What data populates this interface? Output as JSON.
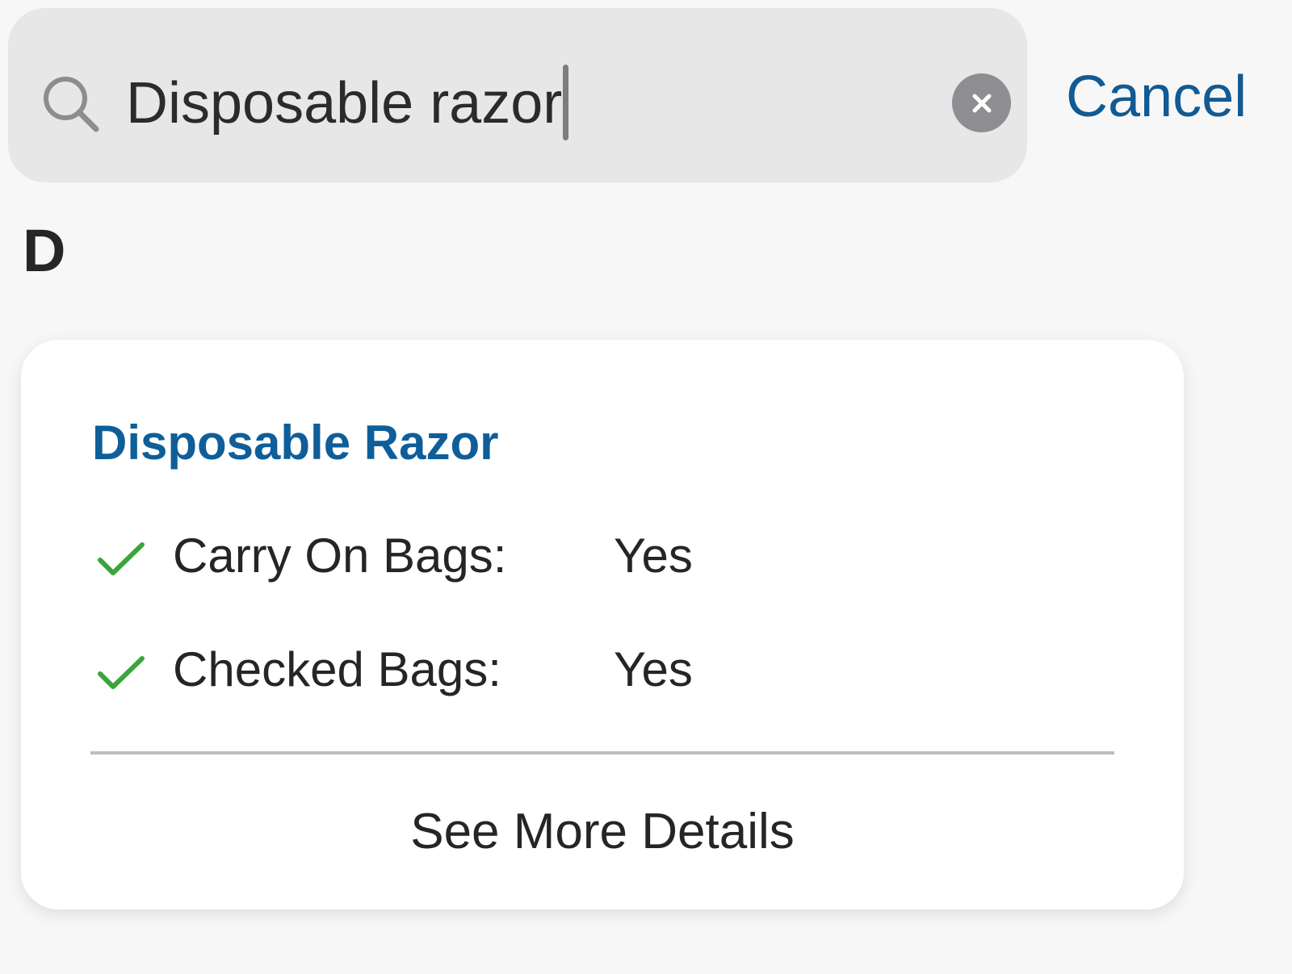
{
  "search": {
    "value": "Disposable razor",
    "cancel_label": "Cancel",
    "search_icon": "search-icon",
    "clear_icon": "clear-icon"
  },
  "results": {
    "section_letter": "D",
    "card": {
      "title": "Disposable Razor",
      "rows": [
        {
          "icon": "checkmark-icon",
          "label": "Carry On Bags:",
          "value": "Yes"
        },
        {
          "icon": "checkmark-icon",
          "label": "Checked Bags:",
          "value": "Yes"
        }
      ],
      "details_label": "See More Details"
    }
  },
  "colors": {
    "accent_blue": "#115a93",
    "title_blue": "#0e5e99",
    "check_green": "#3aa53a",
    "search_bg": "#e7e7e7",
    "page_bg": "#f7f7f7",
    "card_bg": "#ffffff",
    "clear_button_gray": "#8e8e92"
  }
}
